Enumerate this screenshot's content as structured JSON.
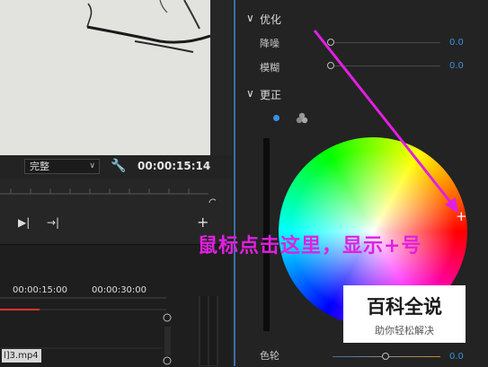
{
  "preview": {
    "quality": "完整",
    "timecode": "00:00:15:14"
  },
  "timeline": {
    "tc_a": "00:00:15:00",
    "tc_b": "00:00:30:00",
    "clip_name": "l]3.mp4"
  },
  "effects": {
    "section_optimize": "优化",
    "noise_label": "降噪",
    "noise_value": "0.0",
    "blur_label": "模糊",
    "blur_value": "0.0",
    "section_correct": "更正",
    "wheel_label": "色轮",
    "wheel_value": "0.0"
  },
  "annotation": "鼠标点击这里，显示+号",
  "watermark": {
    "title": "百科全说",
    "subtitle": "助你轻松解决"
  },
  "colors": {
    "accent_blue": "#3b8fe0",
    "annotation_magenta": "#e020e0",
    "playhead_red": "#e03030"
  },
  "icons": {
    "wrench": "wrench-icon",
    "step_forward": "step-forward-icon",
    "jump_end": "jump-to-end-icon",
    "add": "plus-icon"
  }
}
